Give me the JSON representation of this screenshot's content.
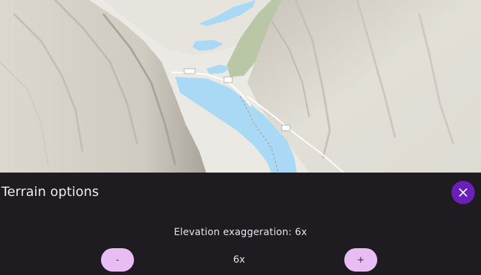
{
  "map": {
    "labels": {
      "road_badge_a": "",
      "water_label_a": "",
      "water_label_b": ""
    }
  },
  "panel": {
    "title": "Terrain options",
    "close_icon": "close-icon",
    "elevation_label": "Elevation exaggeration: 6x",
    "decrease_label": "-",
    "increase_label": "+",
    "current_value": "6x"
  },
  "colors": {
    "panel_bg": "#1f1c21",
    "close_button": "#6a1fb8",
    "step_button": "#e8bdf4",
    "water": "#a9d9f4",
    "terrain": "#e4e1d8"
  }
}
